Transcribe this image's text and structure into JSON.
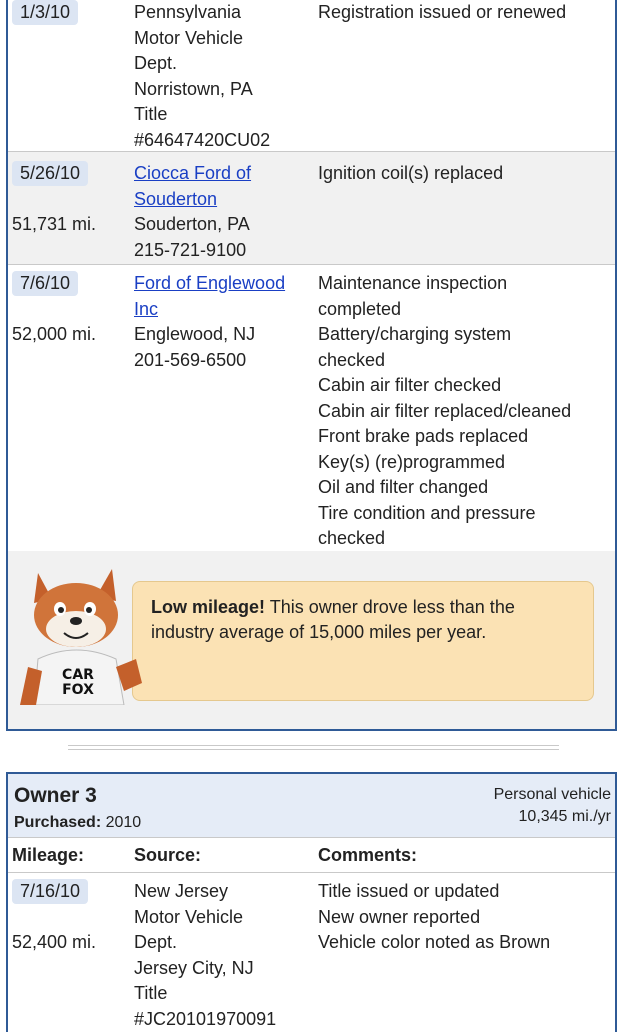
{
  "records": [
    {
      "date": "1/3/10",
      "mileage": "",
      "source_link": [],
      "source_lines": [
        "Pennsylvania",
        "Motor Vehicle",
        "Dept.",
        "Norristown, PA",
        "Title",
        "#64647420CU02"
      ],
      "comments": [
        "Registration issued or renewed"
      ]
    },
    {
      "date": "5/26/10",
      "mileage": "51,731 mi.",
      "source_link": [
        "Ciocca Ford of",
        "Souderton"
      ],
      "source_lines": [
        "Souderton, PA",
        "215-721-9100"
      ],
      "comments": [
        "Ignition coil(s) replaced"
      ]
    },
    {
      "date": "7/6/10",
      "mileage": "52,000 mi.",
      "source_link": [
        "Ford of Englewood",
        "Inc"
      ],
      "source_lines": [
        "Englewood, NJ",
        "201-569-6500"
      ],
      "comments": [
        "Maintenance inspection",
        "completed",
        "Battery/charging system",
        "checked",
        "Cabin air filter checked",
        "Cabin air filter replaced/cleaned",
        "Front brake pads replaced",
        "Key(s) (re)programmed",
        "Oil and filter changed",
        "Tire condition and pressure",
        "checked"
      ]
    }
  ],
  "callout": {
    "bold": "Low mileage!",
    "text": " This owner drove less than the industry average of 15,000 miles per year.",
    "mascot_shirt": [
      "CAR",
      "FOX"
    ]
  },
  "owner3": {
    "title": "Owner 3",
    "purchased_label": "Purchased:",
    "purchased_value": " 2010",
    "type": "Personal vehicle",
    "rate": "10,345 mi./yr",
    "headers": {
      "mileage": "Mileage:",
      "source": "Source:",
      "comments": "Comments:"
    },
    "record": {
      "date": "7/16/10",
      "mileage": "52,400 mi.",
      "source_lines": [
        "New Jersey",
        "Motor Vehicle",
        "Dept.",
        "Jersey City, NJ",
        "Title",
        "#JC20101970091"
      ],
      "comments": [
        "Title issued or updated",
        "New owner reported",
        "Vehicle color noted as Brown"
      ]
    }
  },
  "colors": {
    "border": "#2f5a96",
    "link": "#1a3fc4",
    "callout_bg": "#fbe2b4",
    "header_bg": "#e5ecf7"
  }
}
